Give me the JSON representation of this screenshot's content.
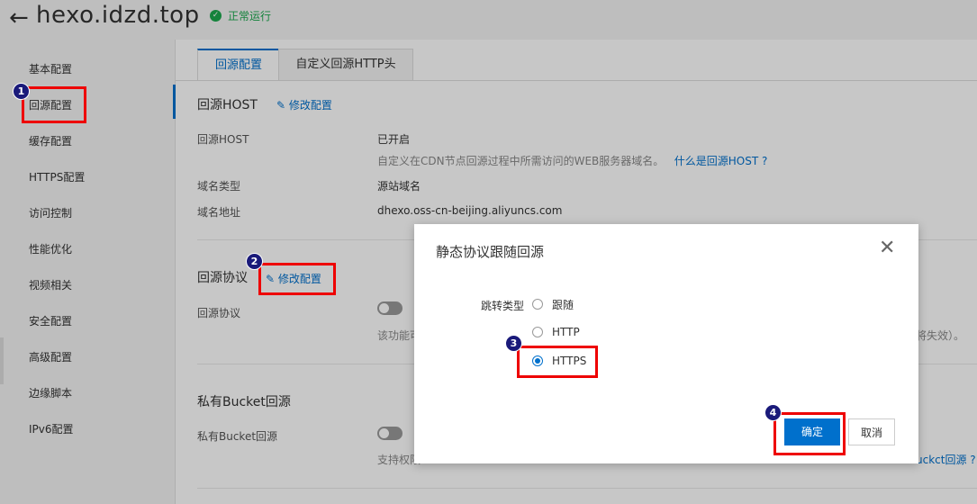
{
  "header": {
    "back_icon": "arrow-left-icon",
    "domain": "hexo.idzd.top",
    "status_icon": "check-circle-icon",
    "status": "正常运行"
  },
  "sidebar": {
    "items": [
      {
        "label": "基本配置"
      },
      {
        "label": "回源配置"
      },
      {
        "label": "缓存配置"
      },
      {
        "label": "HTTPS配置"
      },
      {
        "label": "访问控制"
      },
      {
        "label": "性能优化"
      },
      {
        "label": "视频相关"
      },
      {
        "label": "安全配置"
      },
      {
        "label": "高级配置"
      },
      {
        "label": "边缘脚本"
      },
      {
        "label": "IPv6配置"
      }
    ]
  },
  "tabs": [
    {
      "label": "回源配置"
    },
    {
      "label": "自定义回源HTTP头"
    }
  ],
  "origin_host": {
    "title": "回源HOST",
    "edit": "修改配置",
    "host_label": "回源HOST",
    "host_value": "已开启",
    "host_desc": "自定义在CDN节点回源过程中所需访问的WEB服务器域名。",
    "host_help": "什么是回源HOST ?",
    "type_label": "域名类型",
    "type_value": "源站域名",
    "addr_label": "域名地址",
    "addr_value": "dhexo.oss-cn-beijing.aliyuncs.com"
  },
  "origin_protocol": {
    "title": "回源协议",
    "edit": "修改配置",
    "label": "回源协议",
    "desc_partial": "该功能可",
    "desc_tail": "将失效）。"
  },
  "private_bucket": {
    "title": "私有Bucket回源",
    "label": "私有Bucket回源",
    "desc_partial": "支持权限",
    "help_tail": "uckct回源 ?"
  },
  "modal": {
    "title": "静态协议跟随回源",
    "close_icon": "close-icon",
    "field_label": "跳转类型",
    "options": [
      {
        "label": "跟随",
        "checked": false
      },
      {
        "label": "HTTP",
        "checked": false
      },
      {
        "label": "HTTPS",
        "checked": true
      }
    ],
    "ok": "确定",
    "cancel": "取消"
  },
  "annotations": {
    "steps": [
      "1",
      "2",
      "3",
      "4"
    ],
    "highlight_color": "#e00000"
  }
}
